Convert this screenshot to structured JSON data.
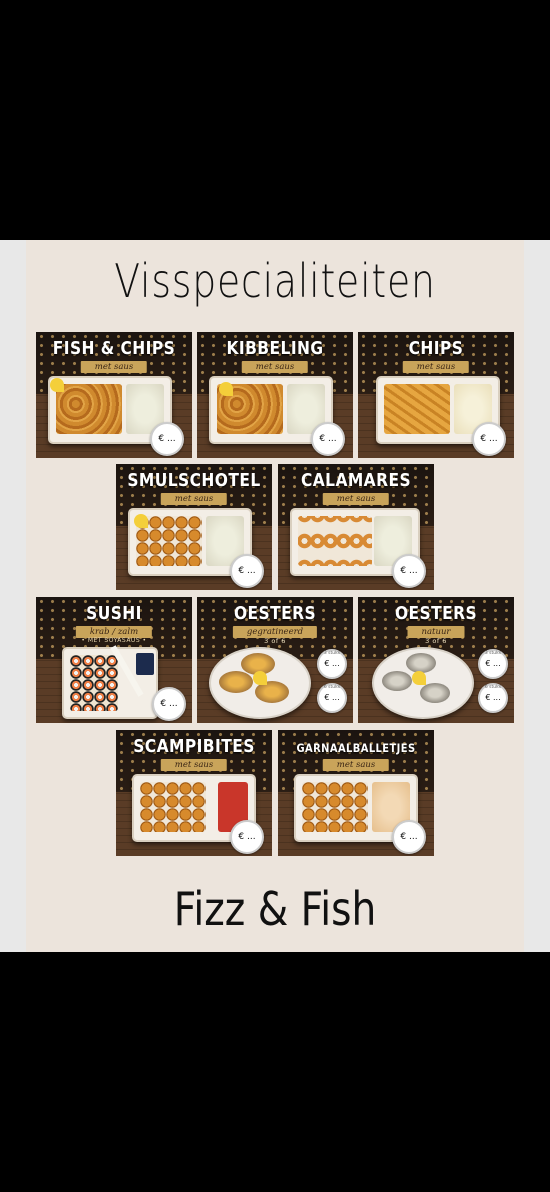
{
  "title": "Visspecialiteiten",
  "footer": "Fizz & Fish",
  "price_symbol": "€ ...",
  "cards": [
    {
      "name": "FISH & CHIPS",
      "subtitle": "met saus"
    },
    {
      "name": "KIBBELING",
      "subtitle": "met saus"
    },
    {
      "name": "CHIPS",
      "subtitle": "met saus"
    },
    {
      "name": "SMULSCHOTEL",
      "subtitle": "met saus"
    },
    {
      "name": "CALAMARES",
      "subtitle": "met saus"
    },
    {
      "name": "SUSHI",
      "subtitle": "krab / zalm",
      "note": "• MET SOYASAUS •"
    },
    {
      "name": "OESTERS",
      "subtitle": "gegratineerd",
      "note": "3 of 6",
      "price_caps": [
        "3 stuks",
        "6 stuks"
      ]
    },
    {
      "name": "OESTERS",
      "subtitle": "natuur",
      "note": "3 of 6",
      "price_caps": [
        "3 stuks",
        "6 stuks"
      ]
    },
    {
      "name": "SCAMPIBITES",
      "subtitle": "met saus"
    },
    {
      "name": "GARNAALBALLETJES",
      "subtitle": "met saus"
    }
  ]
}
